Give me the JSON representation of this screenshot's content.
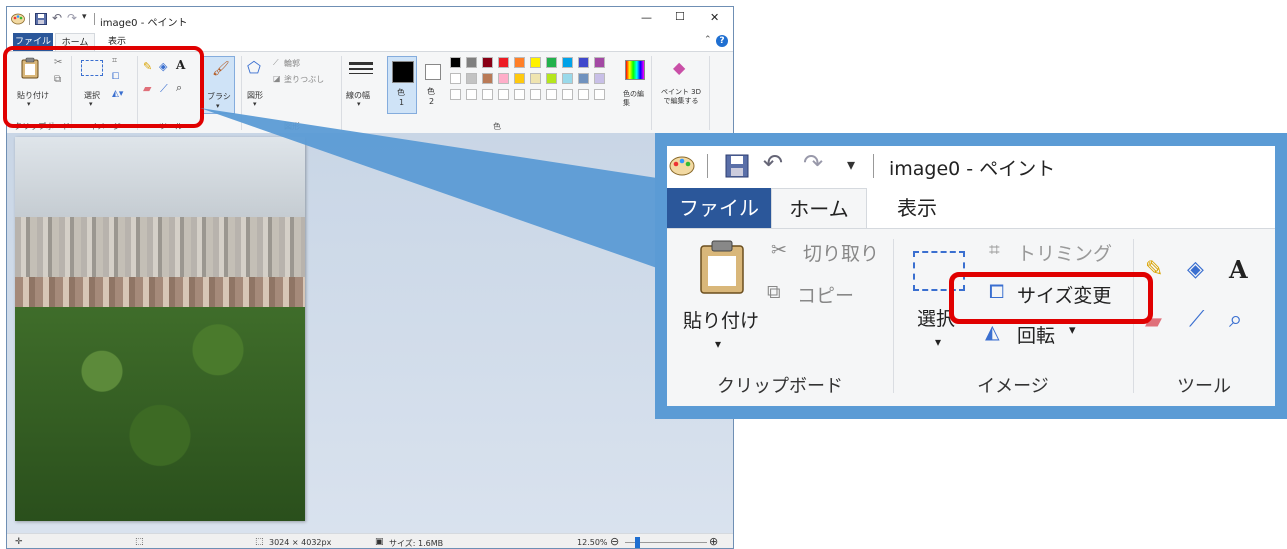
{
  "window": {
    "title": "image0 - ペイント",
    "min_glyph": "—",
    "max_glyph": "☐",
    "close_glyph": "✕",
    "collapse_glyph": "⌃",
    "help_glyph": "?"
  },
  "tabs": [
    {
      "label": "ファイル"
    },
    {
      "label": "ホーム"
    },
    {
      "label": "表示"
    }
  ],
  "ribbon": {
    "paste_label": "貼り付け",
    "select_label": "選択",
    "brush_label": "ブラシ",
    "shapes_label": "図形",
    "outline_label": "輪郭",
    "fill_label": "塗りつぶし",
    "line_width_label": "線の幅",
    "color1_label": "色",
    "color1_num": "1",
    "color2_label": "色",
    "color2_num": "2",
    "edit_colors_label": "色の編集",
    "paint3d_label": "ペイント 3D で編集する",
    "groups": {
      "clipboard": "クリップボード",
      "image": "イメージ",
      "tools": "ツール",
      "shapes": "図形",
      "colors": "色"
    }
  },
  "palette": {
    "row1": [
      "#000000",
      "#7f7f7f",
      "#880015",
      "#ed1c24",
      "#ff7f27",
      "#fff200",
      "#22b14c",
      "#00a2e8",
      "#3f48cc",
      "#a349a4"
    ],
    "row2": [
      "#ffffff",
      "#c3c3c3",
      "#b97a57",
      "#ffaec9",
      "#ffc90e",
      "#efe4b0",
      "#b5e61d",
      "#99d9ea",
      "#7092be",
      "#c8bfe7"
    ]
  },
  "status": {
    "dimensions": "3024 × 4032px",
    "size": "サイズ: 1.6MB",
    "zoom": "12.50%",
    "zoom_minus": "⊖",
    "zoom_plus": "⊕",
    "zoom_fraction": 0.125
  },
  "callout": {
    "title": "image0 - ペイント",
    "tabs": [
      {
        "label": "ファイル"
      },
      {
        "label": "ホーム"
      },
      {
        "label": "表示"
      }
    ],
    "paste": "貼り付け",
    "cut": "切り取り",
    "copy": "コピー",
    "select": "選択",
    "crop": "トリミング",
    "resize": "サイズ変更",
    "rotate": "回転",
    "groups": {
      "clipboard": "クリップボード",
      "image": "イメージ",
      "tools": "ツール"
    }
  },
  "colors": {
    "accent": "#2b579a",
    "highlight": "#e00000",
    "callout": "#5b9bd5"
  }
}
